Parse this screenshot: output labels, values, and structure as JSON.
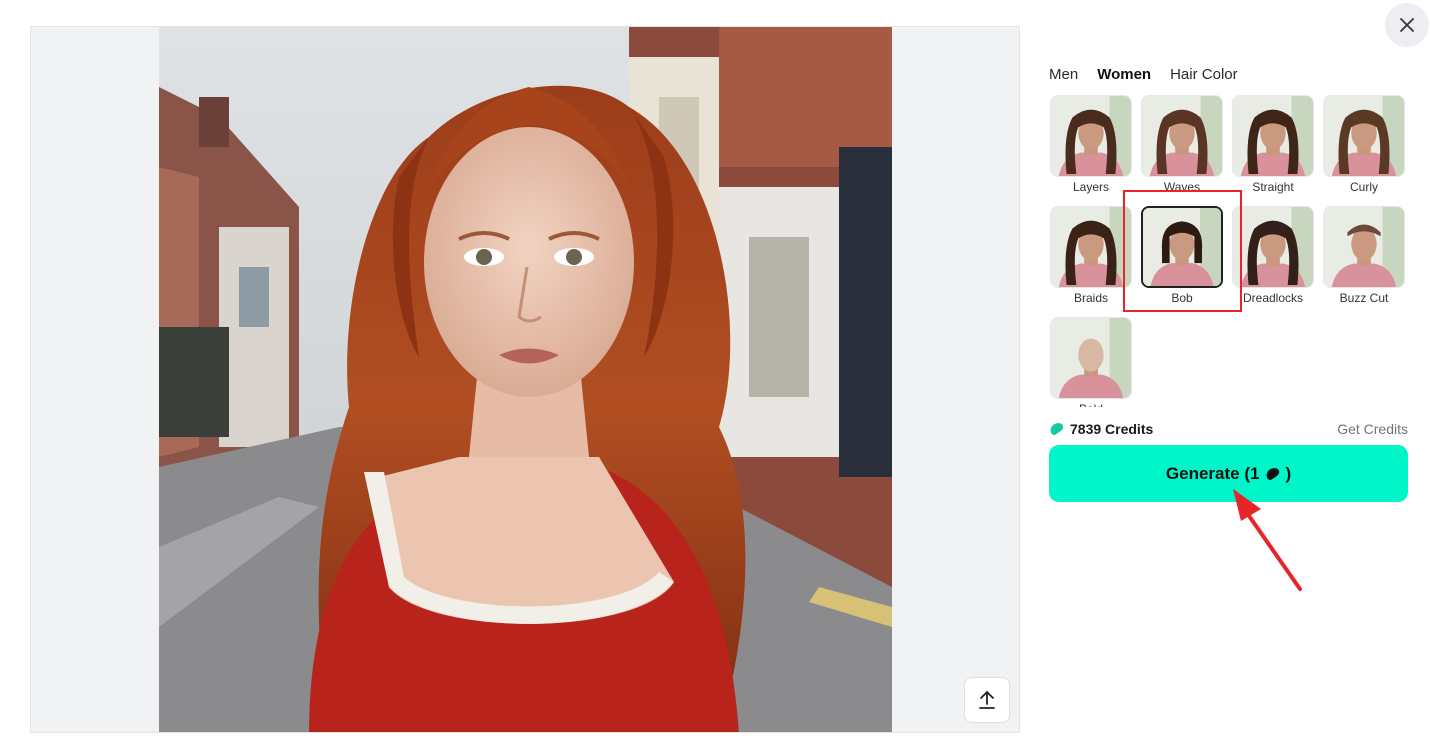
{
  "close_label": "×",
  "tabs": [
    {
      "label": "Men",
      "active": false
    },
    {
      "label": "Women",
      "active": true
    },
    {
      "label": "Hair Color",
      "active": false
    }
  ],
  "styles": [
    {
      "label": "Layers",
      "selected": false
    },
    {
      "label": "Waves",
      "selected": false
    },
    {
      "label": "Straight",
      "selected": false
    },
    {
      "label": "Curly",
      "selected": false
    },
    {
      "label": "Braids",
      "selected": false
    },
    {
      "label": "Bob",
      "selected": true
    },
    {
      "label": "Dreadlocks",
      "selected": false
    },
    {
      "label": "Buzz Cut",
      "selected": false
    },
    {
      "label": "Bald",
      "selected": false
    }
  ],
  "credits": {
    "amount_text": "7839 Credits",
    "get_label": "Get Credits"
  },
  "generate": {
    "label_prefix": "Generate (1",
    "label_suffix": ")"
  },
  "colors": {
    "accent": "#00f5c8",
    "credit_icon": "#18c99e",
    "annotation_red": "#e8232a"
  },
  "icons": {
    "upload": "upload-arrow-icon",
    "close": "close-icon",
    "credit": "credit-bean-icon"
  }
}
